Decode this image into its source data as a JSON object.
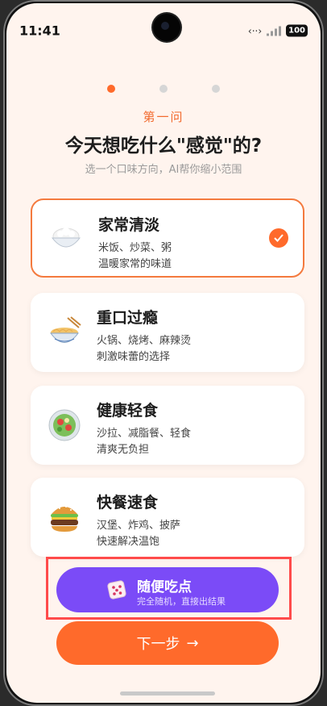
{
  "status": {
    "time": "11:41",
    "battery": "100"
  },
  "progress": {
    "step": 1,
    "total": 3
  },
  "question": {
    "number": "第一问",
    "title": "今天想吃什么\"感觉\"的?",
    "subtitle": "选一个口味方向，AI帮你缩小范围"
  },
  "options": [
    {
      "title": "家常清淡",
      "line1": "米饭、炒菜、粥",
      "line2": "温暖家常的味道",
      "icon": "rice-bowl-icon",
      "selected": true
    },
    {
      "title": "重口过瘾",
      "line1": "火锅、烧烤、麻辣烫",
      "line2": "刺激味蕾的选择",
      "icon": "noodle-bowl-icon",
      "selected": false
    },
    {
      "title": "健康轻食",
      "line1": "沙拉、减脂餐、轻食",
      "line2": "清爽无负担",
      "icon": "salad-icon",
      "selected": false
    },
    {
      "title": "快餐速食",
      "line1": "汉堡、炸鸡、披萨",
      "line2": "快速解决温饱",
      "icon": "burger-icon",
      "selected": false
    }
  ],
  "random_button": {
    "title": "随便吃点",
    "subtitle": "完全随机，直接出结果",
    "icon": "dice-icon"
  },
  "next_button": {
    "label": "下一步",
    "arrow": "→"
  },
  "colors": {
    "accent": "#FF6A2B",
    "purple": "#7B4BF7",
    "highlight": "#FF4B4B",
    "background": "#FFF4EE"
  }
}
